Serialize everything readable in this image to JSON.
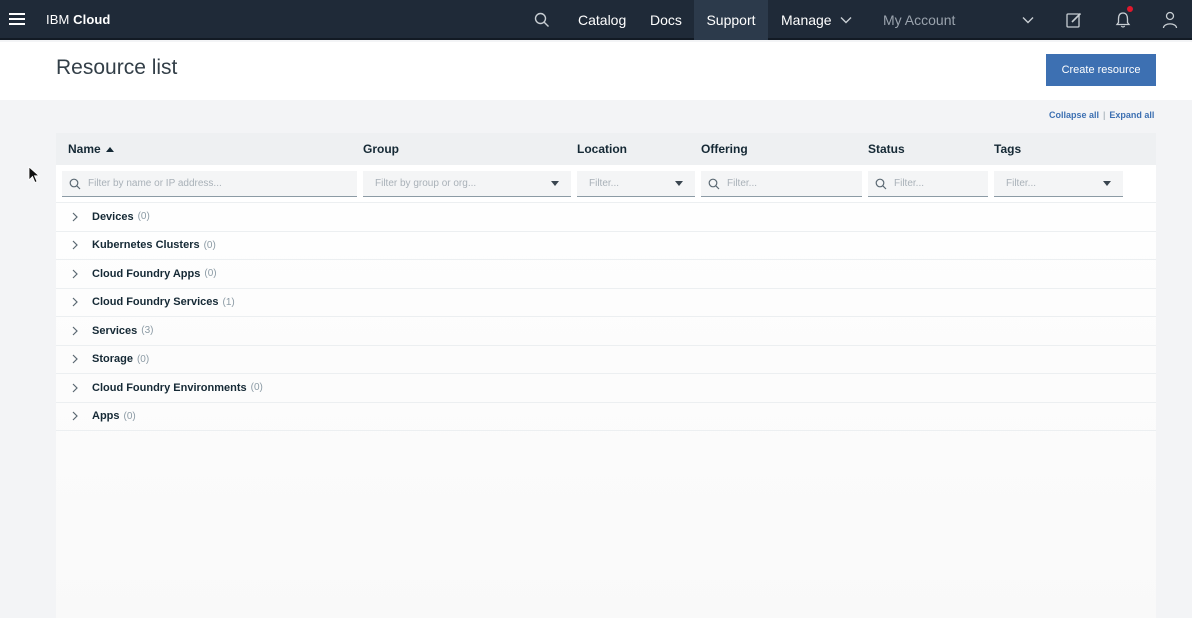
{
  "topnav": {
    "brand_prefix": "IBM",
    "brand_bold": "Cloud",
    "catalog": "Catalog",
    "docs": "Docs",
    "support": "Support",
    "manage": "Manage",
    "account": "My Account",
    "icons": [
      "menu-icon",
      "search-icon",
      "chevron-down-icon",
      "edit-icon",
      "bell-icon",
      "user-icon"
    ]
  },
  "page": {
    "title": "Resource list",
    "create_button": "Create resource",
    "collapse_all": "Collapse all",
    "separator": "|",
    "expand_all": "Expand all"
  },
  "table": {
    "columns": [
      "Name",
      "Group",
      "Location",
      "Offering",
      "Status",
      "Tags"
    ],
    "filters": {
      "name": "Filter by name or IP address...",
      "group": "Filter by group or org...",
      "location": "Filter...",
      "offering": "Filter...",
      "status": "Filter...",
      "tags": "Filter..."
    },
    "rows": [
      {
        "name": "Devices",
        "count": "(0)"
      },
      {
        "name": "Kubernetes Clusters",
        "count": "(0)"
      },
      {
        "name": "Cloud Foundry Apps",
        "count": "(0)"
      },
      {
        "name": "Cloud Foundry Services",
        "count": "(1)"
      },
      {
        "name": "Services",
        "count": "(3)"
      },
      {
        "name": "Storage",
        "count": "(0)"
      },
      {
        "name": "Cloud Foundry Environments",
        "count": "(0)"
      },
      {
        "name": "Apps",
        "count": "(0)"
      }
    ]
  },
  "colors": {
    "nav_bg": "#1f2a38",
    "accent": "#3d70b2",
    "page_bg": "#f3f4f6",
    "notification": "#e0182d"
  }
}
